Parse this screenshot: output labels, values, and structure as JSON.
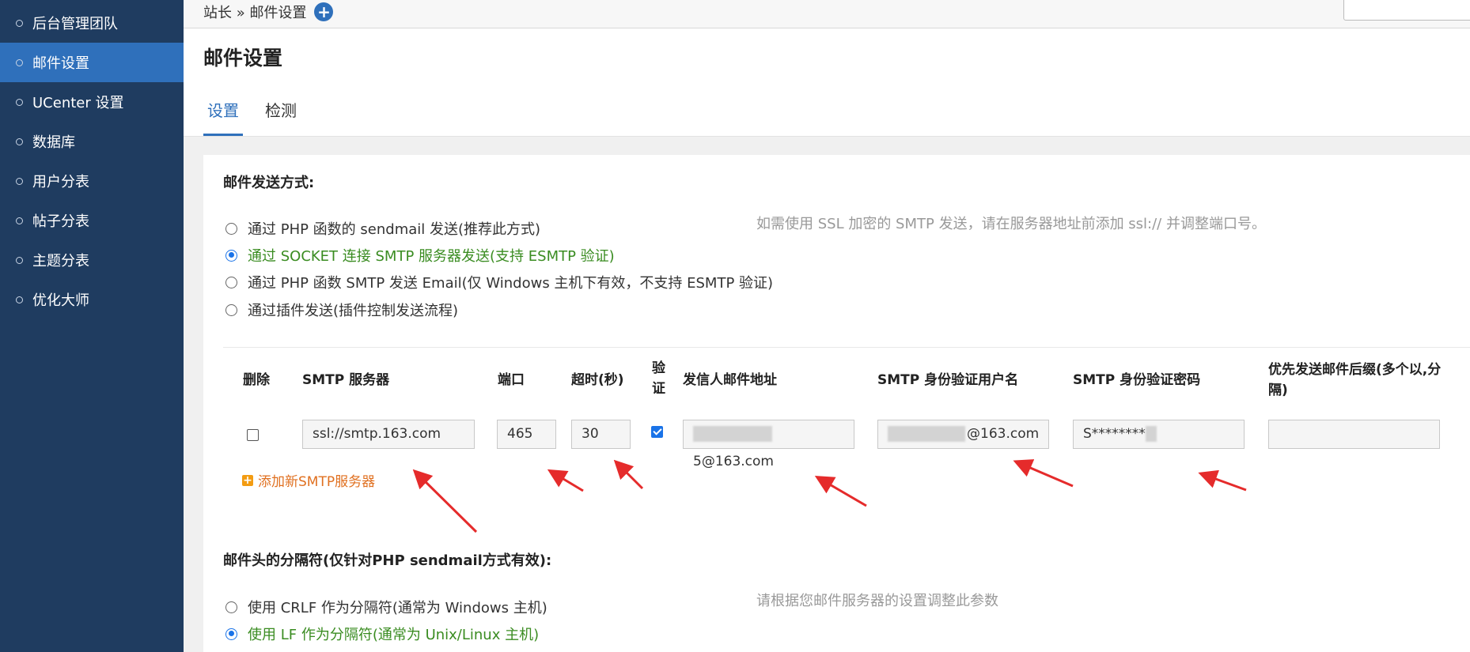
{
  "sidebar": {
    "items": [
      {
        "label": "后台管理团队",
        "active": false
      },
      {
        "label": "邮件设置",
        "active": true
      },
      {
        "label": "UCenter 设置",
        "active": false
      },
      {
        "label": "数据库",
        "active": false
      },
      {
        "label": "用户分表",
        "active": false
      },
      {
        "label": "帖子分表",
        "active": false
      },
      {
        "label": "主题分表",
        "active": false
      },
      {
        "label": "优化大师",
        "active": false
      }
    ]
  },
  "breadcrumb": {
    "text": "站长 » 邮件设置",
    "add": "+"
  },
  "page": {
    "title": "邮件设置"
  },
  "tabs": [
    {
      "label": "设置"
    },
    {
      "label": "检测"
    }
  ],
  "send_method": {
    "title": "邮件发送方式:",
    "hint": "如需使用 SSL 加密的 SMTP 发送，请在服务器地址前添加 ssl:// 并调整端口号。",
    "options": [
      {
        "label": "通过 PHP 函数的 sendmail 发送(推荐此方式)",
        "checked": false
      },
      {
        "label": "通过 SOCKET 连接 SMTP 服务器发送(支持 ESMTP 验证)",
        "checked": true
      },
      {
        "label": "通过 PHP 函数 SMTP 发送 Email(仅 Windows 主机下有效，不支持 ESMTP 验证)",
        "checked": false
      },
      {
        "label": "通过插件发送(插件控制发送流程)",
        "checked": false
      }
    ]
  },
  "smtp_table": {
    "headers": {
      "delete": "删除",
      "server": "SMTP 服务器",
      "port": "端口",
      "timeout": "超时(秒)",
      "auth1": "验",
      "auth2": "证",
      "from": "发信人邮件地址",
      "user": "SMTP 身份验证用户名",
      "password": "SMTP 身份验证密码",
      "suffix1": "优先发送邮件后缀(多个以,分",
      "suffix2": "隔)"
    },
    "row": {
      "delete_checked": false,
      "server": "ssl://smtp.163.com",
      "port": "465",
      "timeout": "30",
      "auth_checked": true,
      "from_visible": "@163.com",
      "from_partial": "5",
      "user_visible": "@163.com",
      "password_visible": "S********",
      "suffix": ""
    },
    "add_label": "添加新SMTP服务器"
  },
  "delimiter": {
    "title": "邮件头的分隔符(仅针对PHP sendmail方式有效):",
    "hint": "请根据您邮件服务器的设置调整此参数",
    "options": [
      {
        "label": "使用 CRLF 作为分隔符(通常为 Windows 主机)",
        "checked": false
      },
      {
        "label": "使用 LF 作为分隔符(通常为 Unix/Linux 主机)",
        "checked": true
      }
    ]
  },
  "colors": {
    "sidebar": "#1f3c60",
    "active": "#2f70bb",
    "selected_text": "#3a8c21",
    "link": "#e07020",
    "arrow": "#e52b2b"
  }
}
